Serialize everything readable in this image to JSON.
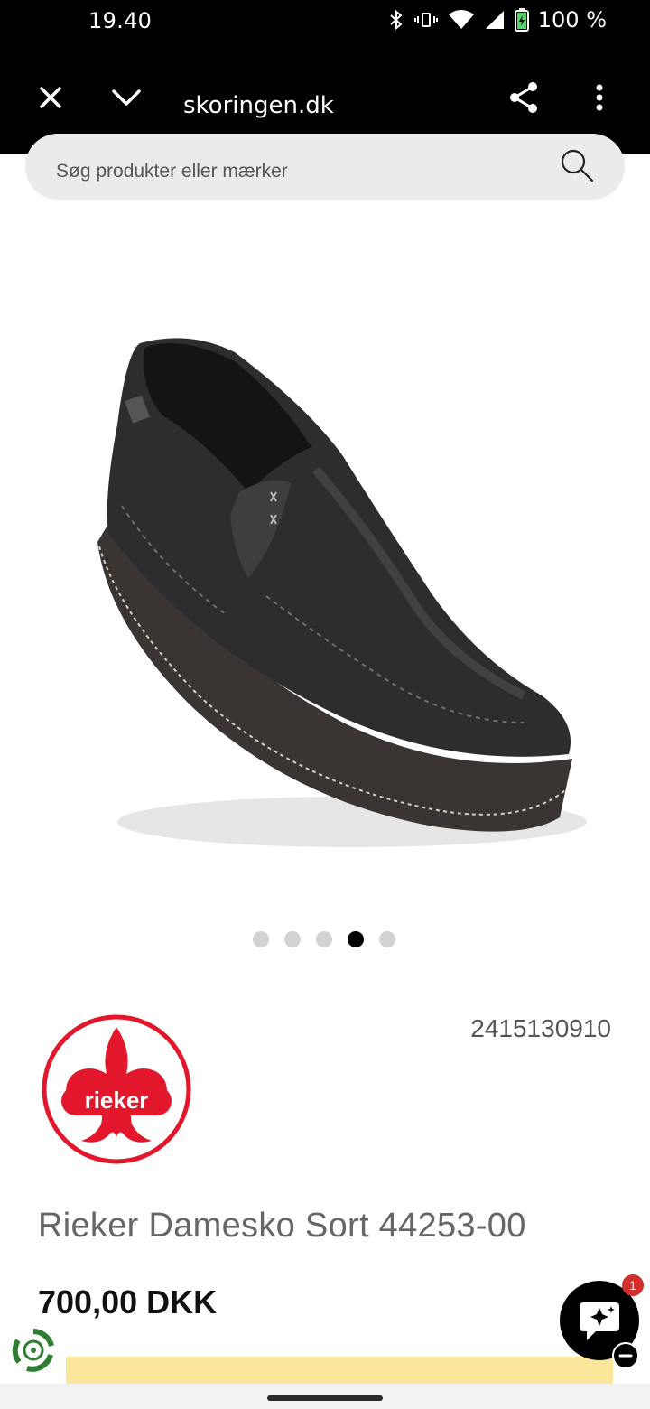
{
  "status_bar": {
    "time": "19.40",
    "battery": "100 %",
    "icons": [
      "bluetooth-icon",
      "vibrate-icon",
      "wifi-icon",
      "signal-icon",
      "battery-icon"
    ]
  },
  "browser": {
    "url": "skoringen.dk",
    "icons": [
      "close-icon",
      "chevron-down-icon",
      "share-icon",
      "more-vert-icon"
    ]
  },
  "search": {
    "placeholder": "Søg produkter eller mærker"
  },
  "gallery": {
    "dot_count": 5,
    "active_index": 3
  },
  "product": {
    "brand_logo_text": "rieker",
    "sku": "2415130910",
    "title": "Rieker Damesko Sort 44253-00",
    "price": "700,00 DKK"
  },
  "chat": {
    "badge_count": "1"
  },
  "colors": {
    "accent_red": "#e3172b",
    "cta_yellow": "#fbe79c",
    "recycle_green": "#2e7d32"
  }
}
